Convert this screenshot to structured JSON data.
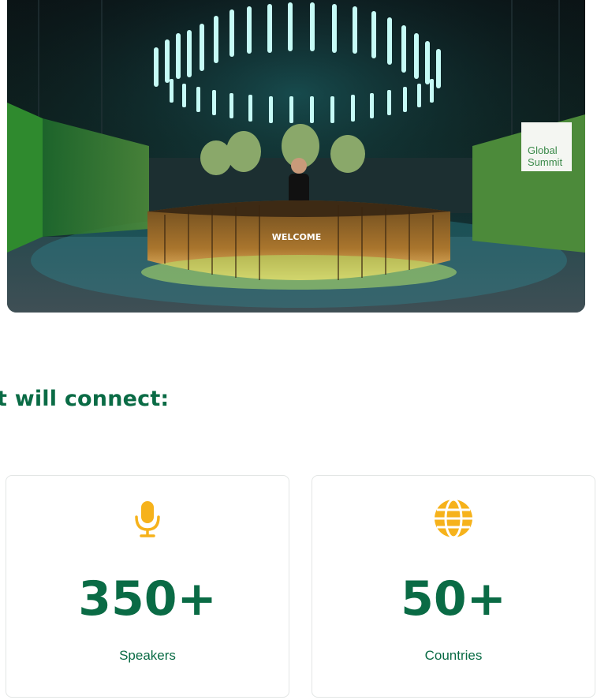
{
  "hero": {
    "welcome_sign": "WELCOME",
    "banner_line1": "Global",
    "banner_line2": "Summit"
  },
  "section": {
    "heading": "t will connect:"
  },
  "stats": [
    {
      "icon": "microphone-icon",
      "value": "350+",
      "label": "Speakers"
    },
    {
      "icon": "globe-icon",
      "value": "50+",
      "label": "Countries"
    }
  ],
  "colors": {
    "accent_green": "#0a6b45",
    "icon_yellow": "#f6b21b",
    "card_border": "#e3e6e5"
  }
}
